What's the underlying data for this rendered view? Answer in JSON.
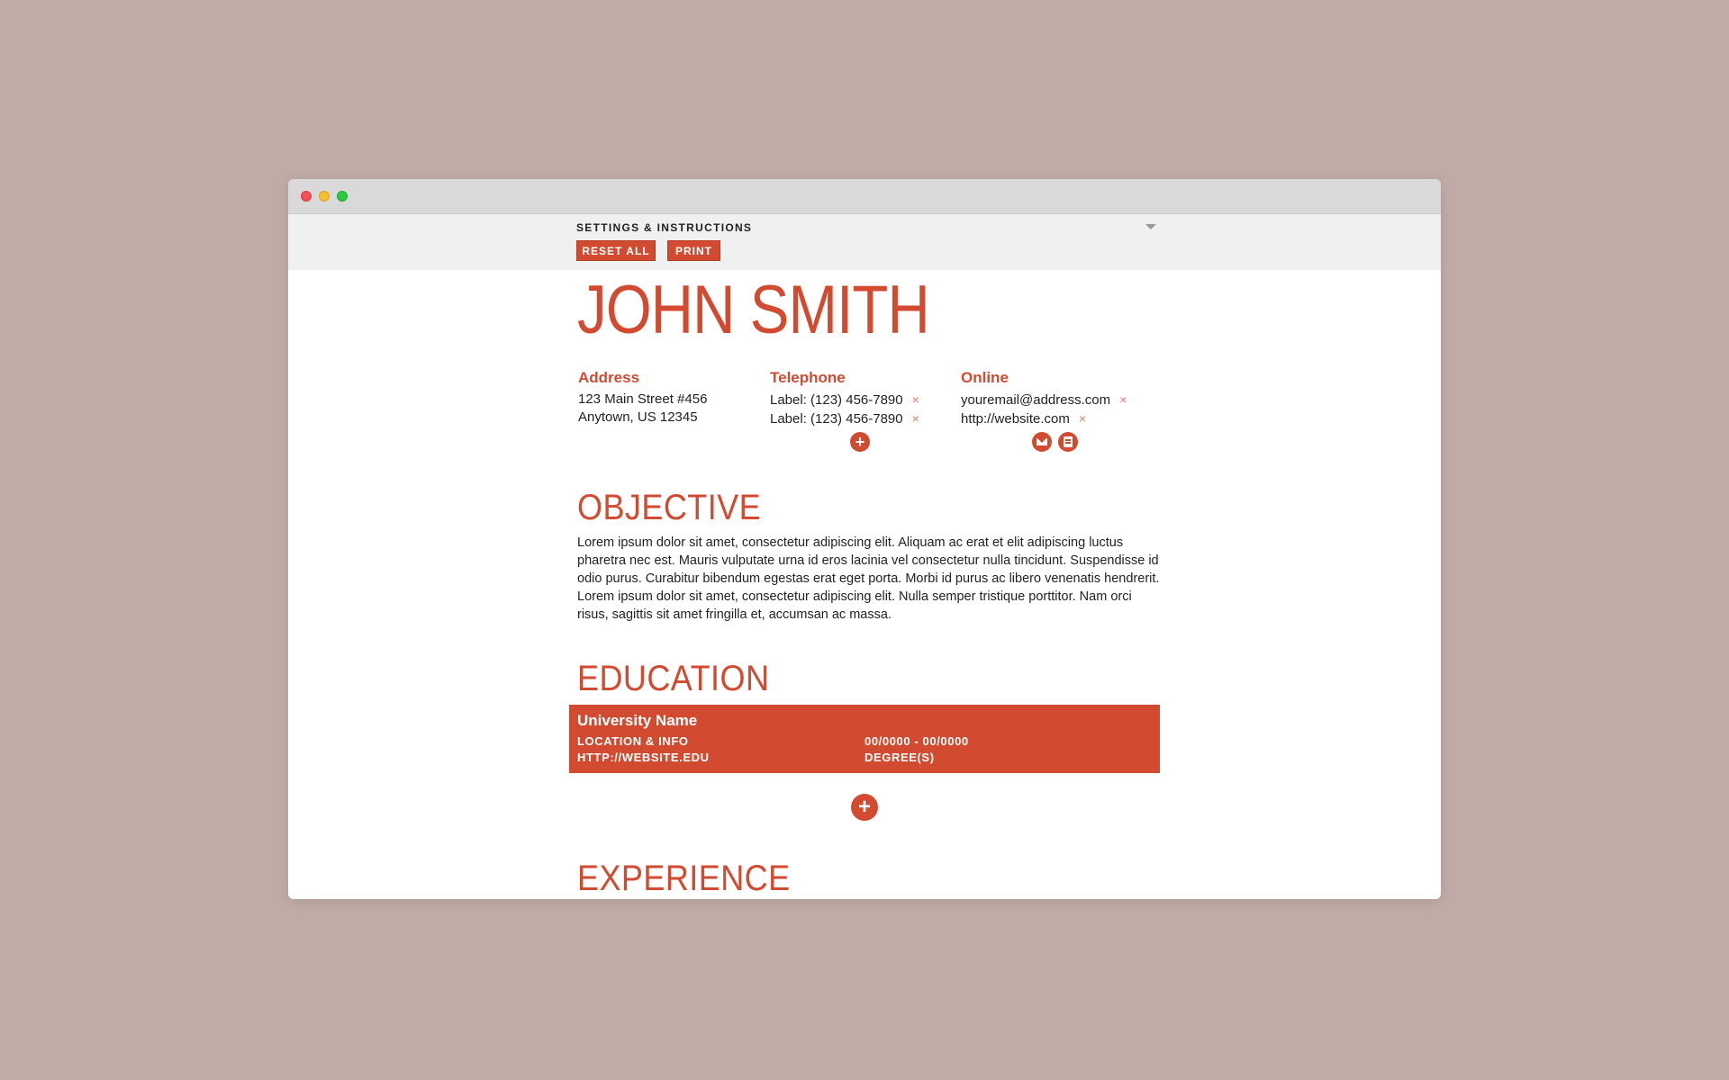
{
  "settings": {
    "title": "SETTINGS & INSTRUCTIONS",
    "reset_label": "RESET ALL",
    "print_label": "PRINT"
  },
  "resume": {
    "name": "JOHN SMITH",
    "address": {
      "heading": "Address",
      "lines": [
        "123 Main Street #456",
        "Anytown, US 12345"
      ]
    },
    "telephone": {
      "heading": "Telephone",
      "lines": [
        "Label: (123) 456-7890",
        "Label: (123) 456-7890"
      ]
    },
    "online": {
      "heading": "Online",
      "lines": [
        "youremail@address.com",
        "http://website.com"
      ]
    },
    "remove_glyph": "×",
    "add_glyph": "+",
    "objective": {
      "heading": "OBJECTIVE",
      "text": "Lorem ipsum dolor sit amet, consectetur adipiscing elit. Aliquam ac erat et elit adipiscing luctus pharetra nec est. Mauris vulputate urna id eros lacinia vel consectetur nulla tincidunt. Suspendisse id odio purus. Curabitur bibendum egestas erat eget porta. Morbi id purus ac libero venenatis hendrerit. Lorem ipsum dolor sit amet, consectetur adipiscing elit. Nulla semper tristique porttitor. Nam orci risus, sagittis sit amet fringilla et, accumsan ac massa."
    },
    "education": {
      "heading": "EDUCATION",
      "entry": {
        "name": "University Name",
        "location": "LOCATION & INFO",
        "website": "HTTP://WEBSITE.EDU",
        "dates": "00/0000 - 00/0000",
        "degree": "DEGREE(S)"
      }
    },
    "experience": {
      "heading": "EXPERIENCE"
    }
  },
  "colors": {
    "accent": "#d24a2f",
    "background": "#c0aba6",
    "settings_bar": "#f0f0f0"
  },
  "icons": {
    "add": "plus-circle-icon",
    "remove": "close-icon",
    "email": "envelope-icon",
    "web": "webpage-icon"
  }
}
